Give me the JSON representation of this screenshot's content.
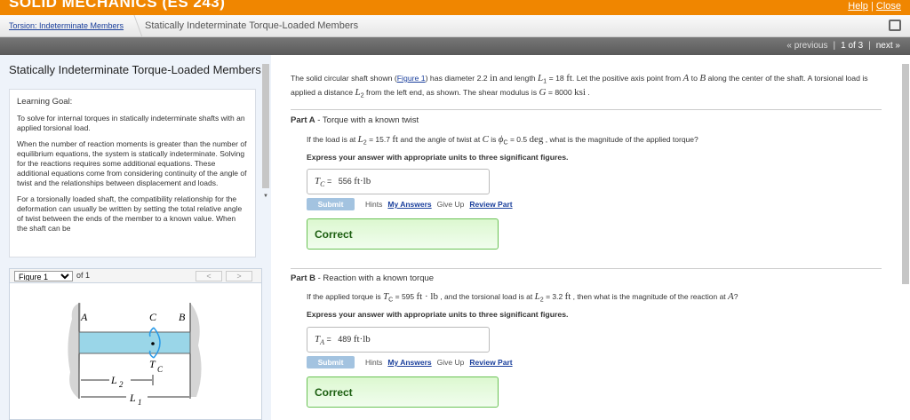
{
  "header": {
    "title": "SOLID MECHANICS (ES 243)",
    "help": "Help",
    "close": "Close",
    "separator": "|"
  },
  "breadcrumb": {
    "parent": "Torsion: Indeterminate Members",
    "current": "Statically Indeterminate Torque-Loaded Members"
  },
  "pager": {
    "previous": "« previous",
    "position": "1 of 3",
    "next": "next »",
    "sep": "|"
  },
  "left": {
    "title": "Statically Indeterminate Torque-Loaded Members",
    "goal_heading": "Learning Goal:",
    "paragraphs": [
      "To solve for internal torques in statically indeterminate shafts with an applied torsional load.",
      "When the number of reaction moments is greater than the number of equilibrium equations, the system is statically indeterminate. Solving for the reactions requires some additional equations. These additional equations come from considering continuity of the angle of twist and the relationships between displacement and loads.",
      "For a torsionally loaded shaft, the compatibility relationship for the deformation can usually be written by setting the total relative angle of twist between the ends of the member to a known value. When the shaft can be"
    ],
    "figure": {
      "select": "Figure 1",
      "of": "of 1",
      "prev": "<",
      "next": ">",
      "labels": {
        "A": "A",
        "B": "B",
        "C": "C",
        "T": "T",
        "Tsub": "C",
        "L2": "L",
        "L2sub": "2",
        "L1": "L",
        "L1sub": "1"
      }
    }
  },
  "intro": {
    "t1": "The solid circular shaft shown (",
    "link": "Figure 1",
    "t2": ") has diameter 2.2 ",
    "u1": "in",
    "t3": " and length ",
    "L1": "L",
    "L1s": "1",
    "t4": " = 18 ",
    "u2": "ft",
    "t5": ". Let the positive axis point from ",
    "A": "A",
    "t6": " to ",
    "B": "B",
    "t7": " along the center of the shaft. A torsional load is applied a distance ",
    "L2": "L",
    "L2s": "2",
    "t8": " from the left end, as shown. The shear modulus is ",
    "G": "G",
    "t9": " = 8000 ",
    "u3": "ksi",
    "t10": " ."
  },
  "partA": {
    "label": "Part A",
    "title": " - Torque with a known twist",
    "q": {
      "t1": "If the load is at ",
      "L": "L",
      "Ls": "2",
      "t2": " = 15.7 ",
      "u1": "ft",
      "t3": " and the angle of twist at ",
      "C": "C",
      "t4": " is ",
      "phi": "ϕ",
      "phis": "C",
      "t5": " = 0.5 ",
      "u2": "deg",
      "t6": " , what is the magnitude of the applied torque?"
    },
    "express": "Express your answer with appropriate units to three significant figures.",
    "var": "T",
    "vars": "C",
    "answer": "556",
    "unit": "ft·lb",
    "submit": "Submit",
    "hints": "Hints",
    "my_answers": "My Answers",
    "give_up": "Give Up",
    "review": "Review Part",
    "result": "Correct"
  },
  "partB": {
    "label": "Part B",
    "title": " - Reaction with a known torque",
    "q": {
      "t1": "If the applied torque is ",
      "T": "T",
      "Ts": "C",
      "t2": " = 595 ",
      "u1": "ft · lb",
      "t3": " , and the torsional load is at ",
      "L": "L",
      "Ls": "2",
      "t4": " = 3.2 ",
      "u2": "ft",
      "t5": " , then what is the magnitude of the reaction at ",
      "A": "A",
      "t6": "?"
    },
    "express": "Express your answer with appropriate units to three significant figures.",
    "var": "T",
    "vars": "A",
    "answer": "489",
    "unit": "ft·lb",
    "submit": "Submit",
    "hints": "Hints",
    "my_answers": "My Answers",
    "give_up": "Give Up",
    "review": "Review Part",
    "result": "Correct"
  }
}
